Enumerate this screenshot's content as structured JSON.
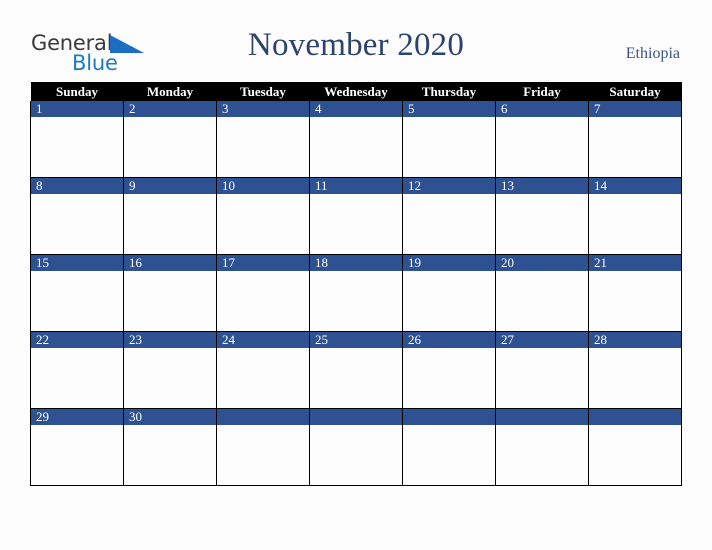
{
  "brand": {
    "name_part1": "General",
    "name_part2": "Blue",
    "color_dark": "#3a3a3a",
    "color_blue": "#1b7ac4"
  },
  "header": {
    "title": "November 2020",
    "country": "Ethiopia",
    "title_color": "#2c4370"
  },
  "calendar": {
    "weekday_headers": [
      "Sunday",
      "Monday",
      "Tuesday",
      "Wednesday",
      "Thursday",
      "Friday",
      "Saturday"
    ],
    "header_bg": "#000000",
    "header_text_color": "#ffffff",
    "daynum_bg": "#2e5191",
    "daynum_text_color": "#ffffff",
    "cell_bg": "#fdfdfd",
    "border_color": "#000000",
    "weeks": [
      {
        "days": [
          {
            "num": "1",
            "events": ""
          },
          {
            "num": "2",
            "events": ""
          },
          {
            "num": "3",
            "events": ""
          },
          {
            "num": "4",
            "events": ""
          },
          {
            "num": "5",
            "events": ""
          },
          {
            "num": "6",
            "events": ""
          },
          {
            "num": "7",
            "events": ""
          }
        ]
      },
      {
        "days": [
          {
            "num": "8",
            "events": ""
          },
          {
            "num": "9",
            "events": ""
          },
          {
            "num": "10",
            "events": ""
          },
          {
            "num": "11",
            "events": ""
          },
          {
            "num": "12",
            "events": ""
          },
          {
            "num": "13",
            "events": ""
          },
          {
            "num": "14",
            "events": ""
          }
        ]
      },
      {
        "days": [
          {
            "num": "15",
            "events": ""
          },
          {
            "num": "16",
            "events": ""
          },
          {
            "num": "17",
            "events": ""
          },
          {
            "num": "18",
            "events": ""
          },
          {
            "num": "19",
            "events": ""
          },
          {
            "num": "20",
            "events": ""
          },
          {
            "num": "21",
            "events": ""
          }
        ]
      },
      {
        "days": [
          {
            "num": "22",
            "events": ""
          },
          {
            "num": "23",
            "events": ""
          },
          {
            "num": "24",
            "events": ""
          },
          {
            "num": "25",
            "events": ""
          },
          {
            "num": "26",
            "events": ""
          },
          {
            "num": "27",
            "events": ""
          },
          {
            "num": "28",
            "events": ""
          }
        ]
      },
      {
        "days": [
          {
            "num": "29",
            "events": ""
          },
          {
            "num": "30",
            "events": ""
          },
          {
            "num": "",
            "events": ""
          },
          {
            "num": "",
            "events": ""
          },
          {
            "num": "",
            "events": ""
          },
          {
            "num": "",
            "events": ""
          },
          {
            "num": "",
            "events": ""
          }
        ]
      }
    ]
  }
}
